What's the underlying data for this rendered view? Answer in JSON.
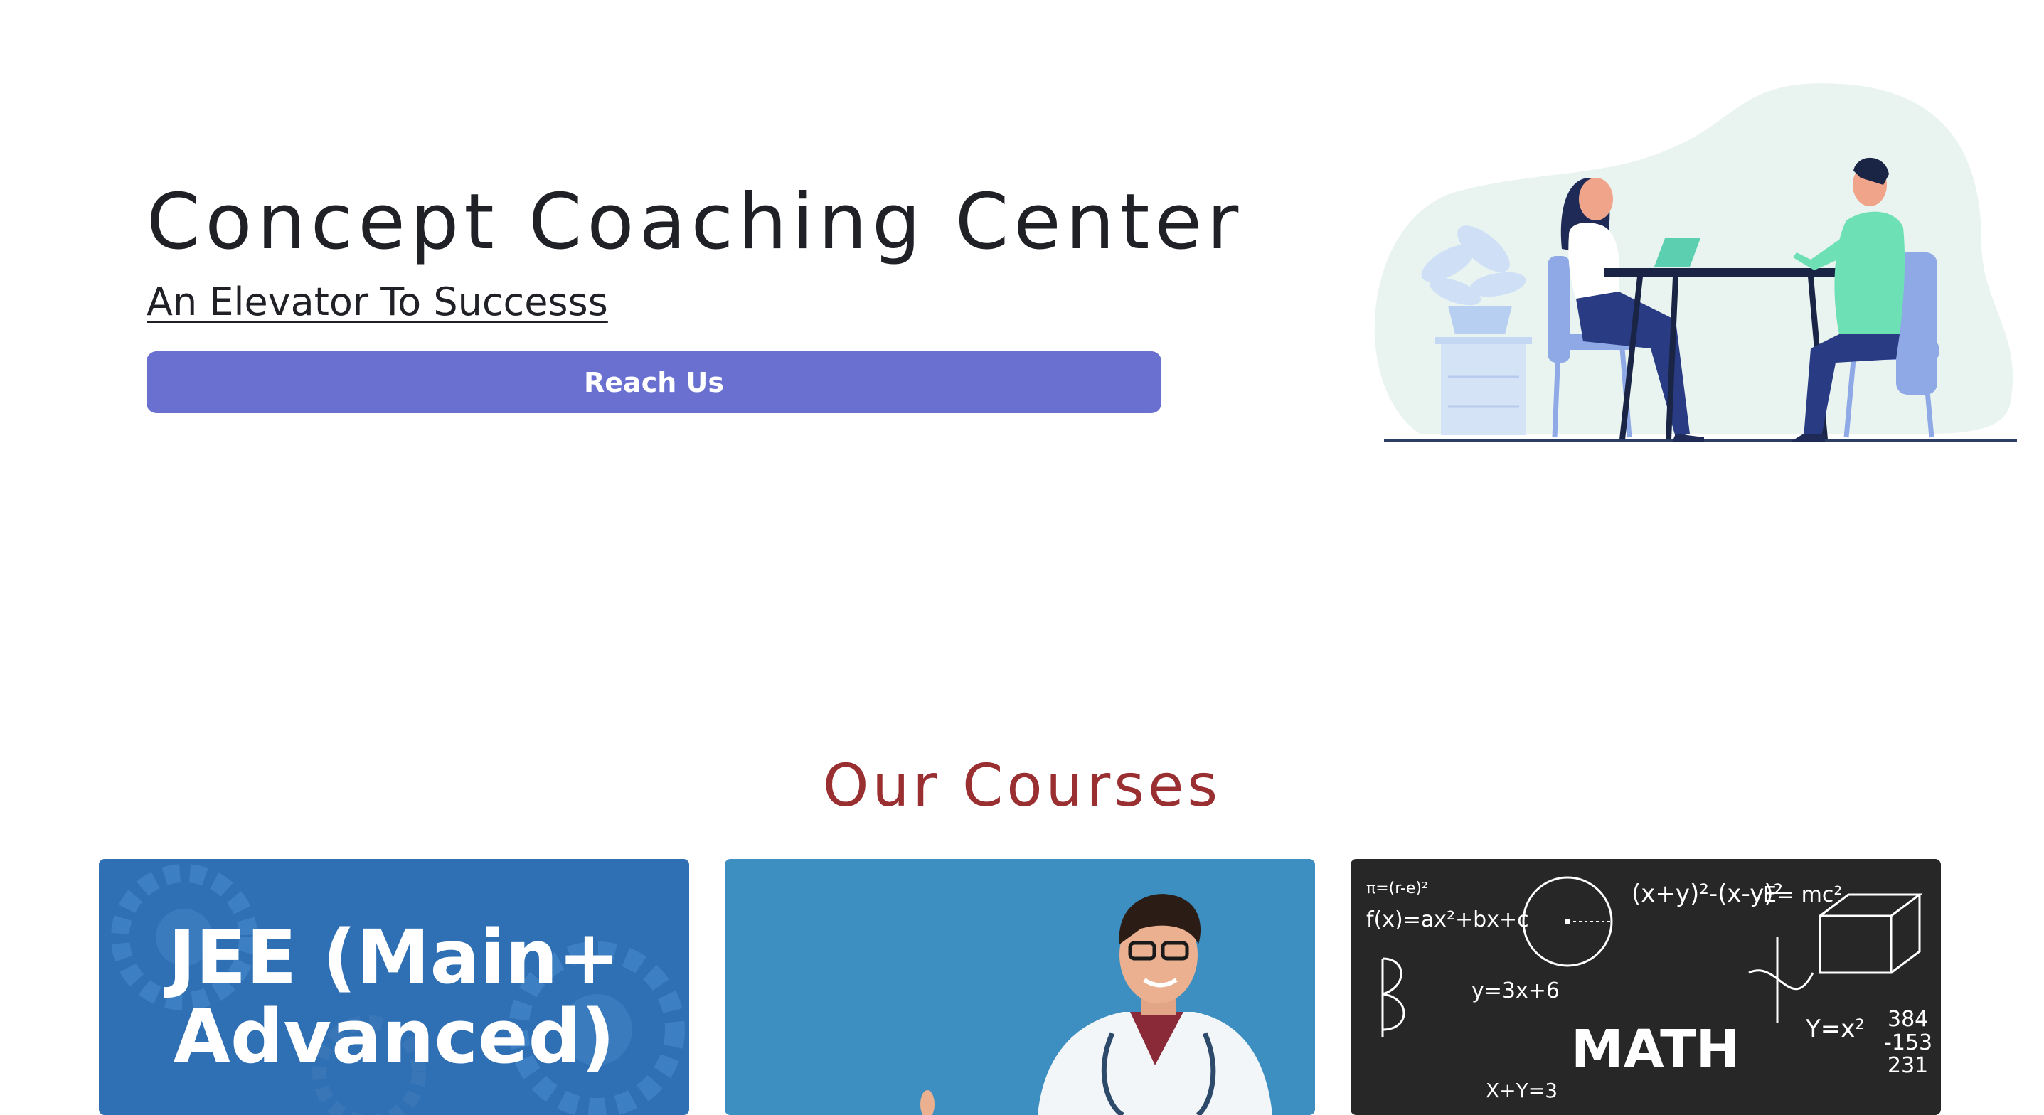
{
  "hero": {
    "title": "Concept Coaching Center",
    "tagline": "An Elevator To Successs",
    "button_label": "Reach Us",
    "button_color": "#6970d0",
    "illustration": "two-people-meeting-at-table-illustration"
  },
  "courses": {
    "title": "Our Courses",
    "title_color": "#9a2f31",
    "cards": [
      {
        "image_text_line1": "JEE (Main+",
        "image_text_line2": "Advanced)",
        "image": "gears-background"
      },
      {
        "image": "smiling-doctor-with-stethoscope"
      },
      {
        "image_text": "MATH",
        "image": "chalkboard-formulas"
      }
    ]
  },
  "chalkboard_formulas": {
    "f1": "f(x)=ax²+bx+c",
    "f2": "(x+y)²-(x-y)²",
    "f3": "E= mc²",
    "f4": "y=3x+6",
    "f5": "Y=x²",
    "f6": "384",
    "f7": "-153",
    "f8": "231",
    "f9": "X+Y=3",
    "f10": "π=(r-e)²"
  }
}
